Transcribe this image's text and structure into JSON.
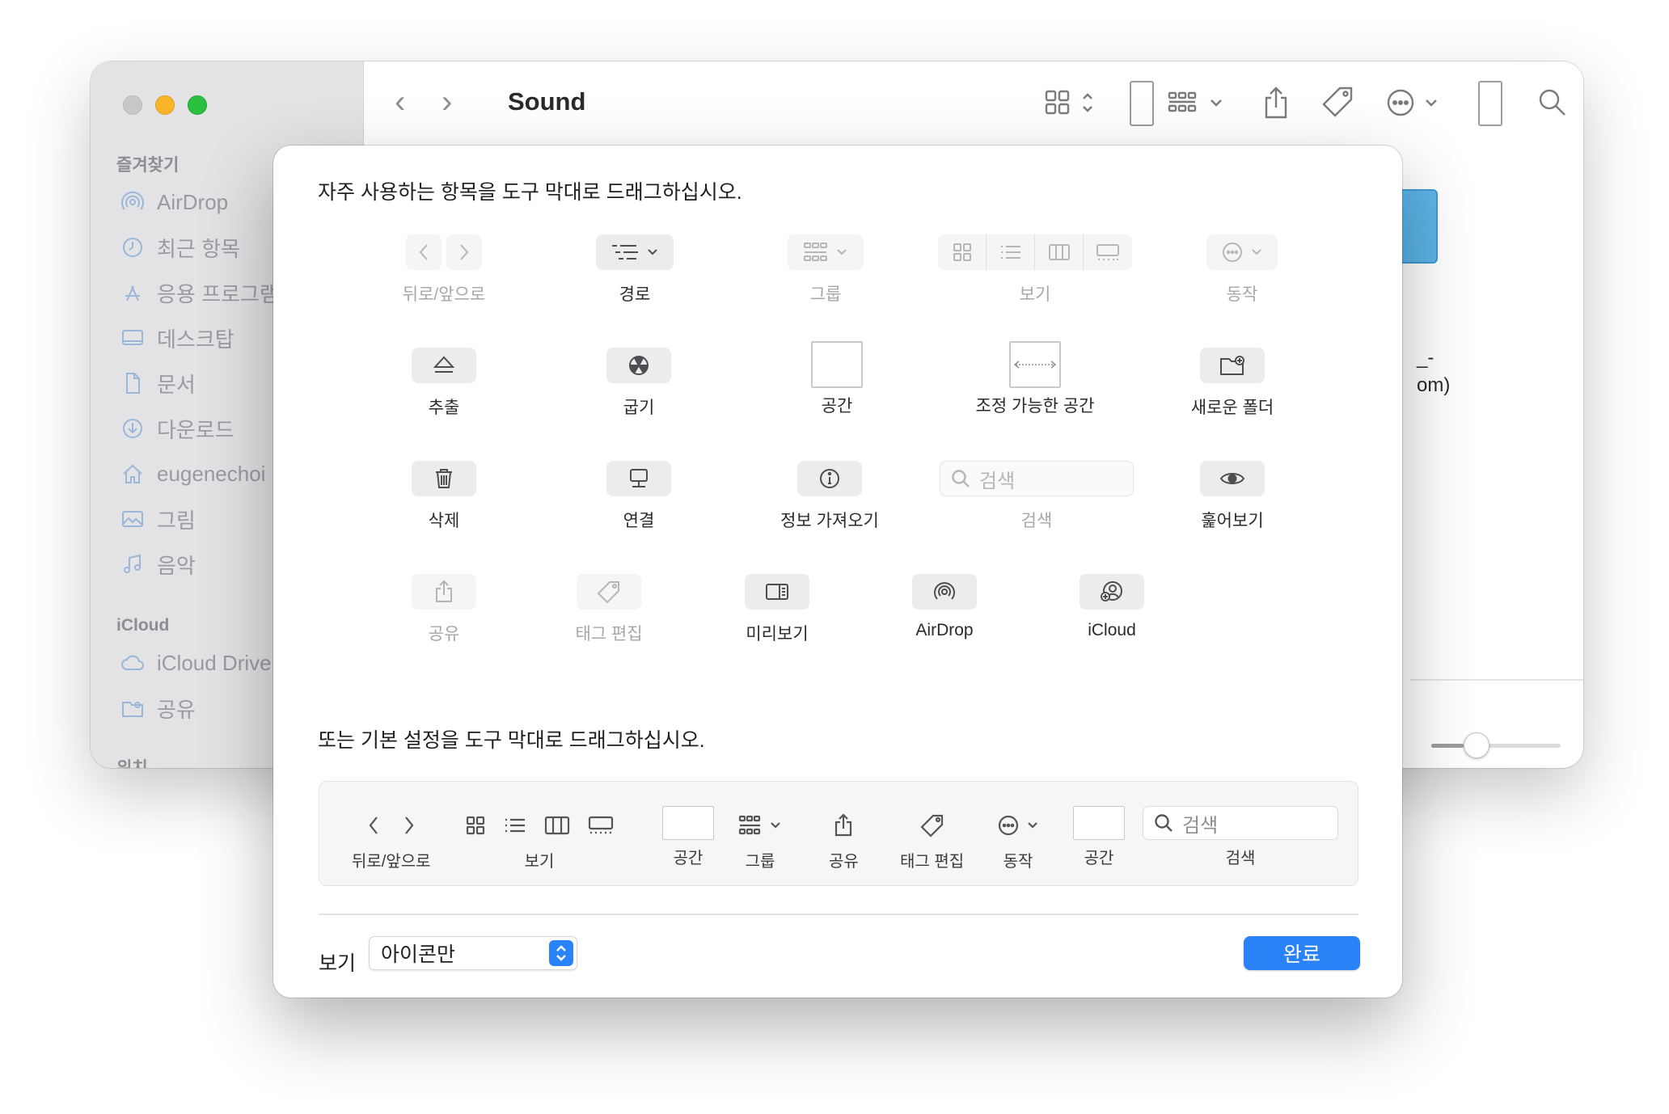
{
  "finder": {
    "title": "Sound",
    "back_glyph": "‹",
    "forward_glyph": "›",
    "filename_line1": "_-",
    "filename_line2": "om)",
    "sidebar": {
      "favorites_header": "즐겨찾기",
      "favorites": [
        {
          "label": "AirDrop",
          "icon": "airdrop-icon"
        },
        {
          "label": "최근 항목",
          "icon": "clock-icon"
        },
        {
          "label": "응용 프로그램",
          "icon": "applications-icon"
        },
        {
          "label": "데스크탑",
          "icon": "desktop-icon"
        },
        {
          "label": "문서",
          "icon": "document-icon"
        },
        {
          "label": "다운로드",
          "icon": "download-icon"
        },
        {
          "label": "eugenechoi",
          "icon": "home-icon"
        },
        {
          "label": "그림",
          "icon": "photo-icon"
        },
        {
          "label": "음악",
          "icon": "music-icon"
        }
      ],
      "icloud_header": "iCloud",
      "icloud": [
        {
          "label": "iCloud Drive",
          "icon": "cloud-icon"
        },
        {
          "label": "공유",
          "icon": "shared-folder-icon"
        }
      ],
      "locations_header": "위치"
    }
  },
  "sheet": {
    "instruction_top": "자주 사용하는 항목을 도구 막대로 드래그하십시오.",
    "instruction_bottom": "또는 기본 설정을 도구 막대로 드래그하십시오.",
    "palette": {
      "back_forward": "뒤로/앞으로",
      "path": "경로",
      "group": "그룹",
      "view": "보기",
      "action": "동작",
      "eject": "추출",
      "burn": "굽기",
      "space": "공간",
      "flexible_space": "조정 가능한 공간",
      "new_folder": "새로운 폴더",
      "delete": "삭제",
      "connect": "연결",
      "get_info": "정보 가져오기",
      "search": "검색",
      "search_placeholder": "검색",
      "quick_look": "훑어보기",
      "share": "공유",
      "edit_tags": "태그 편집",
      "preview": "미리보기",
      "airdrop": "AirDrop",
      "icloud": "iCloud"
    },
    "default_set": {
      "back_forward": "뒤로/앞으로",
      "view": "보기",
      "space1": "공간",
      "group": "그룹",
      "share": "공유",
      "edit_tags": "태그 편집",
      "action": "동작",
      "space2": "공간",
      "search": "검색",
      "search_placeholder": "검색"
    },
    "show_label": "보기",
    "show_value": "아이콘만",
    "done_label": "완료"
  },
  "colors": {
    "accent": "#2a83f6",
    "sidebar_bg": "#e3e3e6",
    "close": "#c8c8c8",
    "minimize": "#f8b527",
    "zoom": "#29c13f"
  }
}
